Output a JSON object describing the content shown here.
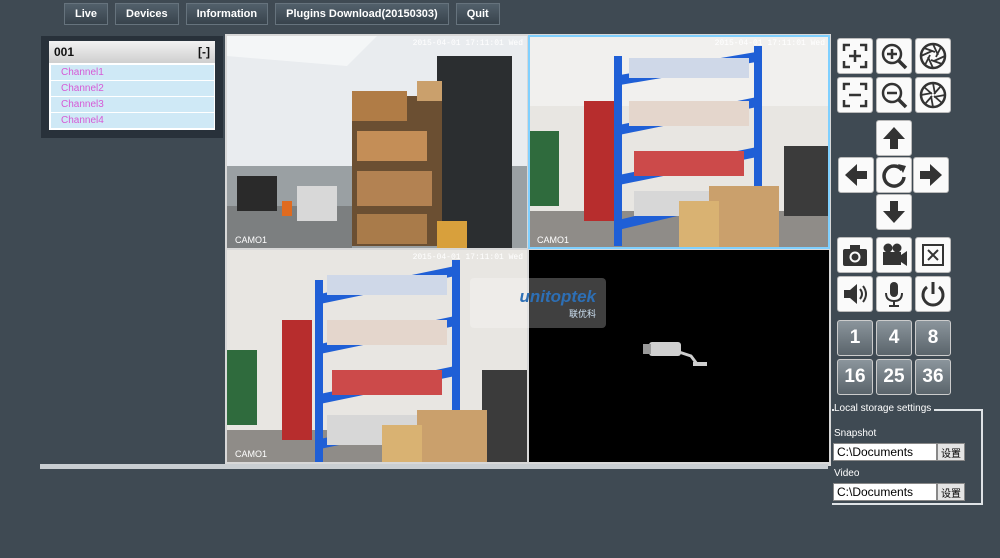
{
  "nav": {
    "live": "Live",
    "devices": "Devices",
    "information": "Information",
    "plugins": "Plugins Download(20150303)",
    "quit": "Quit"
  },
  "device_tree": {
    "device_name": "001",
    "collapse": "[-]",
    "channels": [
      "Channel1",
      "Channel2",
      "Channel3",
      "Channel4"
    ]
  },
  "video": {
    "tiles": [
      {
        "timestamp": "2015-04-01 17:11:01 Wed",
        "camera": "CAMO1"
      },
      {
        "timestamp": "2015-04-01 17:11:01 Wed",
        "camera": "CAMO1"
      },
      {
        "timestamp": "2015-04-01 17:11:01 Wed",
        "camera": "CAMO1"
      }
    ],
    "watermark": {
      "brand": "unitoptek",
      "sub": "联优科"
    }
  },
  "controls": {
    "icons": [
      "zoom-frame-in-icon",
      "zoom-in-icon",
      "iris-open-icon",
      "zoom-frame-out-icon",
      "zoom-out-icon",
      "iris-close-icon",
      "arrow-up-icon",
      "arrow-left-icon",
      "refresh-icon",
      "arrow-right-icon",
      "arrow-down-icon",
      "camera-icon",
      "video-camera-icon",
      "close-x-icon",
      "speaker-icon",
      "microphone-icon",
      "power-icon"
    ],
    "layouts": [
      "1",
      "4",
      "8",
      "16",
      "25",
      "36"
    ]
  },
  "storage": {
    "legend": "Local storage settings",
    "snapshot_label": "Snapshot",
    "snapshot_path": "C:\\Documents",
    "video_label": "Video",
    "video_path": "C:\\Documents",
    "set_button": "设置"
  }
}
